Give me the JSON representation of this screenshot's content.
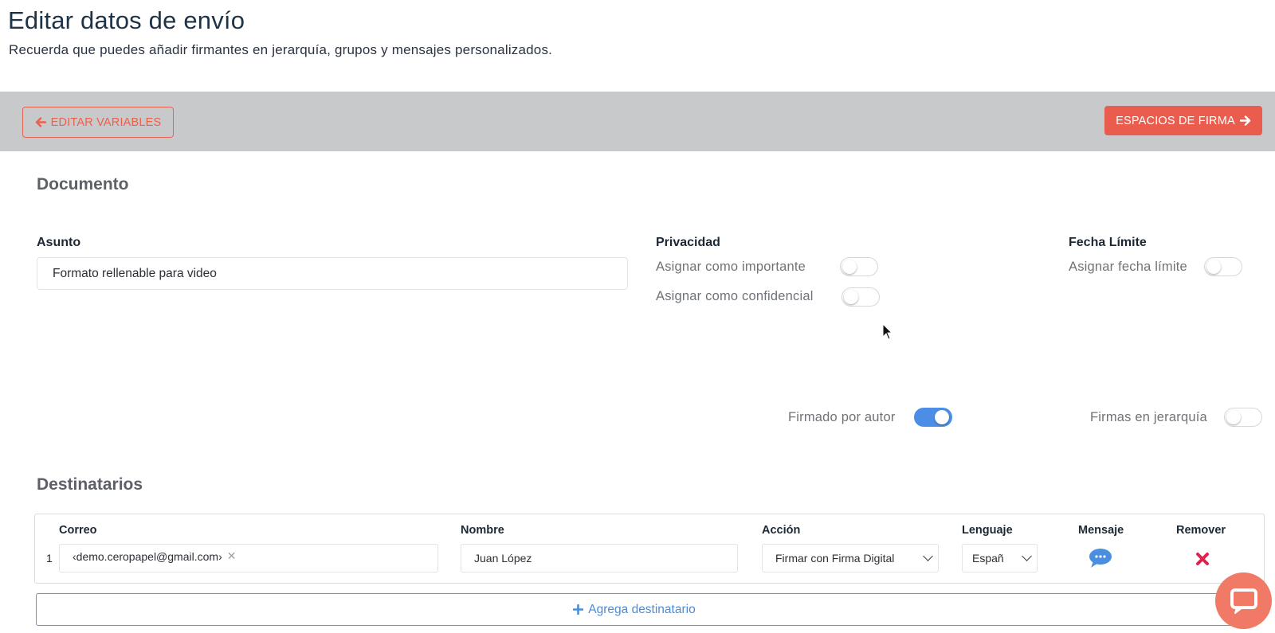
{
  "header": {
    "title": "Editar datos de envío",
    "subtitle": "Recuerda que puedes añadir firmantes en jerarquía, grupos y mensajes personalizados."
  },
  "toolbar": {
    "back_label": "EDITAR VARIABLES",
    "next_label": "ESPACIOS DE FIRMA",
    "accent": "#ea5c4d"
  },
  "document": {
    "section_title": "Documento",
    "subject_label": "Asunto",
    "subject_value": "Formato rellenable para video",
    "privacy_label": "Privacidad",
    "important_label": "Asignar como importante",
    "important_on": false,
    "confidential_label": "Asignar como confidencial",
    "confidential_on": false,
    "deadline_label": "Fecha Límite",
    "deadline_toggle_label": "Asignar fecha límite",
    "deadline_on": false,
    "signed_by_author_label": "Firmado por autor",
    "signed_by_author_on": true,
    "hierarchy_label": "Firmas en jerarquía",
    "hierarchy_on": false
  },
  "recipients": {
    "section_title": "Destinatarios",
    "columns": {
      "email": "Correo",
      "name": "Nombre",
      "action": "Acción",
      "language": "Lenguaje",
      "message": "Mensaje",
      "remove": "Remover"
    },
    "rows": [
      {
        "index": "1",
        "email": "‹demo.ceropapel@gmail.com›",
        "name": "Juan López",
        "action": "Firmar con Firma Digital",
        "language": "Españ"
      }
    ],
    "add_label": "Agrega destinatario"
  },
  "icons": {
    "back": "arrow-left-icon",
    "next": "arrow-right-icon",
    "message": "chat-icon",
    "remove": "close-icon",
    "add": "plus-icon",
    "support": "chat-support-icon"
  },
  "colors": {
    "toggle_on": "#4c8ee6",
    "remove": "#e0224f",
    "link": "#4a8dd6"
  }
}
